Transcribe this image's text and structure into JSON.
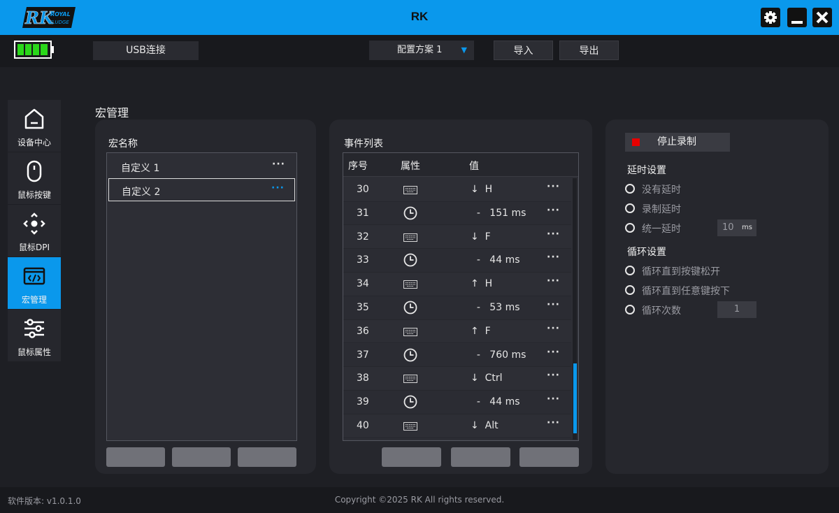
{
  "titlebar": {
    "logo_text": "RK",
    "logo_brand_line1": "ROYAL",
    "logo_brand_line2": "KLUDGE",
    "title": "RK",
    "accent_color": "#0a98ec"
  },
  "topbar": {
    "battery_level": 1.0,
    "connection": "USB连接",
    "profile_selected": "配置方案  1",
    "import_label": "导入",
    "export_label": "导出"
  },
  "sidebar": {
    "items": [
      {
        "label": "设备中心",
        "icon": "home-icon",
        "active": false
      },
      {
        "label": "鼠标按键",
        "icon": "mouse-icon",
        "active": false
      },
      {
        "label": "鼠标DPI",
        "icon": "dpi-icon",
        "active": false
      },
      {
        "label": "宏管理",
        "icon": "code-window-icon",
        "active": true
      },
      {
        "label": "鼠标属性",
        "icon": "sliders-icon",
        "active": false
      }
    ]
  },
  "page_title": "宏管理",
  "macro_panel": {
    "heading": "宏名称",
    "items": [
      {
        "name": "自定义 1",
        "selected": false
      },
      {
        "name": "自定义 2",
        "selected": true
      }
    ]
  },
  "event_panel": {
    "heading": "事件列表",
    "columns": [
      "序号",
      "属性",
      "值"
    ],
    "rows": [
      {
        "seq": "30",
        "type": "keyboard",
        "value": "↓  H"
      },
      {
        "seq": "31",
        "type": "delay",
        "value": "  -   151 ms"
      },
      {
        "seq": "32",
        "type": "keyboard",
        "value": "↓  F"
      },
      {
        "seq": "33",
        "type": "delay",
        "value": "  -   44 ms"
      },
      {
        "seq": "34",
        "type": "keyboard",
        "value": "↑  H"
      },
      {
        "seq": "35",
        "type": "delay",
        "value": "  -   53 ms"
      },
      {
        "seq": "36",
        "type": "keyboard",
        "value": "↑  F"
      },
      {
        "seq": "37",
        "type": "delay",
        "value": "  -   760 ms"
      },
      {
        "seq": "38",
        "type": "keyboard",
        "value": "↓  Ctrl"
      },
      {
        "seq": "39",
        "type": "delay",
        "value": "  -   44 ms"
      },
      {
        "seq": "40",
        "type": "keyboard",
        "value": "↓  Alt"
      }
    ]
  },
  "settings_panel": {
    "stop_record_label": "停止录制",
    "delay_title": "延时设置",
    "delay_options": [
      "没有延时",
      "录制延时",
      "统一延时"
    ],
    "delay_value": "10",
    "delay_unit": "ms",
    "loop_title": "循环设置",
    "loop_options": [
      "循环直到按键松开",
      "循环直到任意键按下",
      "循环次数"
    ],
    "loop_count": "1"
  },
  "footer": {
    "version": "软件版本: v1.0.1.0",
    "copyright": "Copyright ©2025 RK All rights reserved."
  }
}
